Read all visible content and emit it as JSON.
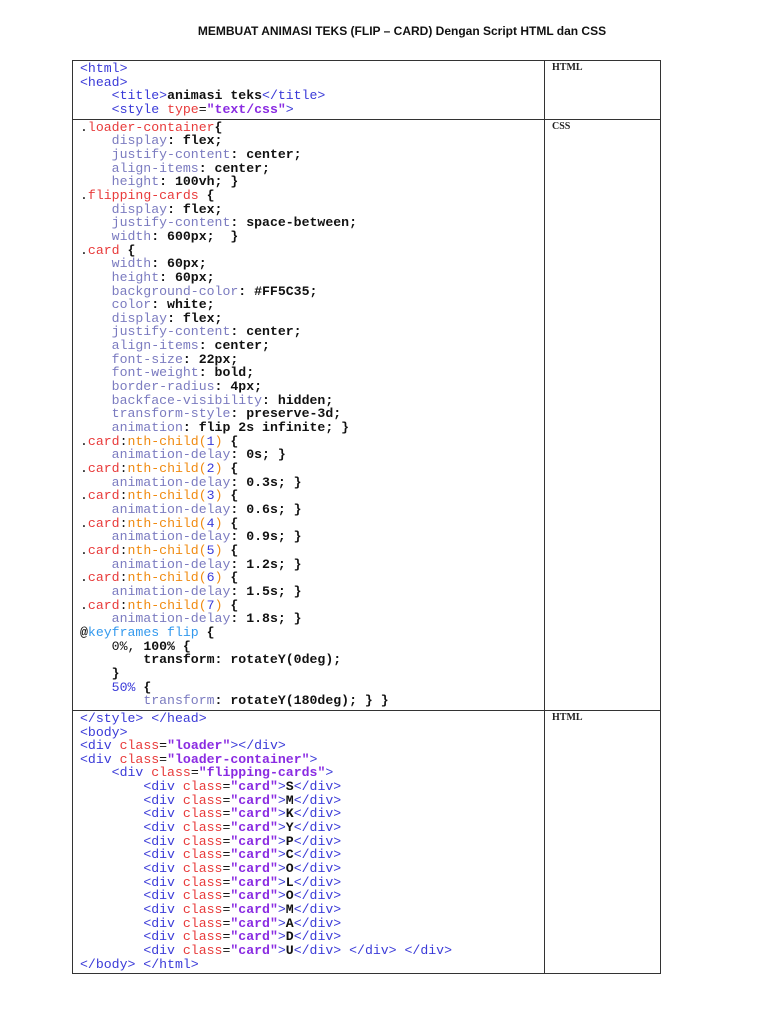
{
  "title": "MEMBUAT ANIMASI TEKS (FLIP – CARD) Dengan Script HTML dan CSS",
  "rows": [
    {
      "label": "HTML",
      "lines": [
        [
          [
            "t",
            "<html>"
          ]
        ],
        [
          [
            "t",
            "<head>"
          ]
        ],
        [
          [
            "d",
            "    "
          ],
          [
            "t",
            "<title>"
          ],
          [
            "k",
            "animasi teks"
          ],
          [
            "t",
            "</title>"
          ]
        ],
        [
          [
            "d",
            "    "
          ],
          [
            "t",
            "<style "
          ],
          [
            "a",
            "type"
          ],
          [
            "d",
            "="
          ],
          [
            "v",
            "\"text/css\""
          ],
          [
            "t",
            ">"
          ]
        ]
      ]
    },
    {
      "label": "CSS",
      "lines": [
        [
          [
            "d",
            "."
          ],
          [
            "s",
            "loader-container"
          ],
          [
            "k",
            "{"
          ]
        ],
        [
          [
            "d",
            "    "
          ],
          [
            "p",
            "display"
          ],
          [
            "k",
            ": flex;"
          ]
        ],
        [
          [
            "d",
            "    "
          ],
          [
            "p",
            "justify-content"
          ],
          [
            "k",
            ": center;"
          ]
        ],
        [
          [
            "d",
            "    "
          ],
          [
            "p",
            "align-items"
          ],
          [
            "k",
            ": center;"
          ]
        ],
        [
          [
            "d",
            "    "
          ],
          [
            "p",
            "height"
          ],
          [
            "k",
            ": 100vh; }"
          ]
        ],
        [
          [
            "d",
            "."
          ],
          [
            "s",
            "flipping-cards"
          ],
          [
            "k",
            " {"
          ]
        ],
        [
          [
            "d",
            "    "
          ],
          [
            "p",
            "display"
          ],
          [
            "k",
            ": flex;"
          ]
        ],
        [
          [
            "d",
            "    "
          ],
          [
            "p",
            "justify-content"
          ],
          [
            "k",
            ": space-between;"
          ]
        ],
        [
          [
            "d",
            "    "
          ],
          [
            "p",
            "width"
          ],
          [
            "k",
            ": 600px;  }"
          ]
        ],
        [
          [
            "d",
            "."
          ],
          [
            "s",
            "card"
          ],
          [
            "k",
            " {"
          ]
        ],
        [
          [
            "d",
            "    "
          ],
          [
            "p",
            "width"
          ],
          [
            "k",
            ": 60px;"
          ]
        ],
        [
          [
            "d",
            "    "
          ],
          [
            "p",
            "height"
          ],
          [
            "k",
            ": 60px;"
          ]
        ],
        [
          [
            "d",
            "    "
          ],
          [
            "p",
            "background-color"
          ],
          [
            "k",
            ": #FF5C35;"
          ]
        ],
        [
          [
            "d",
            "    "
          ],
          [
            "p",
            "color"
          ],
          [
            "k",
            ": white;"
          ]
        ],
        [
          [
            "d",
            "    "
          ],
          [
            "p",
            "display"
          ],
          [
            "k",
            ": flex;"
          ]
        ],
        [
          [
            "d",
            "    "
          ],
          [
            "p",
            "justify-content"
          ],
          [
            "k",
            ": center;"
          ]
        ],
        [
          [
            "d",
            "    "
          ],
          [
            "p",
            "align-items"
          ],
          [
            "k",
            ": center;"
          ]
        ],
        [
          [
            "d",
            "    "
          ],
          [
            "p",
            "font-size"
          ],
          [
            "k",
            ": 22px;"
          ]
        ],
        [
          [
            "d",
            "    "
          ],
          [
            "p",
            "font-weight"
          ],
          [
            "k",
            ": bold;"
          ]
        ],
        [
          [
            "d",
            "    "
          ],
          [
            "p",
            "border-radius"
          ],
          [
            "k",
            ": 4px;"
          ]
        ],
        [
          [
            "d",
            "    "
          ],
          [
            "p",
            "backface-visibility"
          ],
          [
            "k",
            ": hidden;"
          ]
        ],
        [
          [
            "d",
            "    "
          ],
          [
            "p",
            "transform-style"
          ],
          [
            "k",
            ": preserve-3d;"
          ]
        ],
        [
          [
            "d",
            "    "
          ],
          [
            "p",
            "animation"
          ],
          [
            "k",
            ": flip 2s infinite; }"
          ]
        ],
        [
          [
            "d",
            "."
          ],
          [
            "s",
            "card"
          ],
          [
            "d",
            ":"
          ],
          [
            "o",
            "nth-child("
          ],
          [
            "n",
            "1"
          ],
          [
            "o",
            ")"
          ],
          [
            "k",
            " {"
          ]
        ],
        [
          [
            "d",
            "    "
          ],
          [
            "p",
            "animation-delay"
          ],
          [
            "k",
            ": 0s; }"
          ]
        ],
        [
          [
            "d",
            "."
          ],
          [
            "s",
            "card"
          ],
          [
            "d",
            ":"
          ],
          [
            "o",
            "nth-child("
          ],
          [
            "n",
            "2"
          ],
          [
            "o",
            ")"
          ],
          [
            "k",
            " {"
          ]
        ],
        [
          [
            "d",
            "    "
          ],
          [
            "p",
            "animation-delay"
          ],
          [
            "k",
            ": 0.3s; }"
          ]
        ],
        [
          [
            "d",
            "."
          ],
          [
            "s",
            "card"
          ],
          [
            "d",
            ":"
          ],
          [
            "o",
            "nth-child("
          ],
          [
            "n",
            "3"
          ],
          [
            "o",
            ")"
          ],
          [
            "k",
            " {"
          ]
        ],
        [
          [
            "d",
            "    "
          ],
          [
            "p",
            "animation-delay"
          ],
          [
            "k",
            ": 0.6s; }"
          ]
        ],
        [
          [
            "d",
            "."
          ],
          [
            "s",
            "card"
          ],
          [
            "d",
            ":"
          ],
          [
            "o",
            "nth-child("
          ],
          [
            "n",
            "4"
          ],
          [
            "o",
            ")"
          ],
          [
            "k",
            " {"
          ]
        ],
        [
          [
            "d",
            "    "
          ],
          [
            "p",
            "animation-delay"
          ],
          [
            "k",
            ": 0.9s; }"
          ]
        ],
        [
          [
            "d",
            "."
          ],
          [
            "s",
            "card"
          ],
          [
            "d",
            ":"
          ],
          [
            "o",
            "nth-child("
          ],
          [
            "n",
            "5"
          ],
          [
            "o",
            ")"
          ],
          [
            "k",
            " {"
          ]
        ],
        [
          [
            "d",
            "    "
          ],
          [
            "p",
            "animation-delay"
          ],
          [
            "k",
            ": 1.2s; }"
          ]
        ],
        [
          [
            "d",
            "."
          ],
          [
            "s",
            "card"
          ],
          [
            "d",
            ":"
          ],
          [
            "o",
            "nth-child("
          ],
          [
            "n",
            "6"
          ],
          [
            "o",
            ")"
          ],
          [
            "k",
            " {"
          ]
        ],
        [
          [
            "d",
            "    "
          ],
          [
            "p",
            "animation-delay"
          ],
          [
            "k",
            ": 1.5s; }"
          ]
        ],
        [
          [
            "d",
            "."
          ],
          [
            "s",
            "card"
          ],
          [
            "d",
            ":"
          ],
          [
            "o",
            "nth-child("
          ],
          [
            "n",
            "7"
          ],
          [
            "o",
            ")"
          ],
          [
            "k",
            " {"
          ]
        ],
        [
          [
            "d",
            "    "
          ],
          [
            "p",
            "animation-delay"
          ],
          [
            "k",
            ": 1.8s; }"
          ]
        ],
        [
          [
            "k",
            "@"
          ],
          [
            "kw",
            "keyframes flip"
          ],
          [
            "k",
            " {"
          ]
        ],
        [
          [
            "d",
            "    0%, "
          ],
          [
            "k",
            "100% {"
          ]
        ],
        [
          [
            "d",
            "        "
          ],
          [
            "k",
            "transform: rotateY(0deg);"
          ]
        ],
        [
          [
            "d",
            "    "
          ],
          [
            "k",
            "}"
          ]
        ],
        [
          [
            "d",
            "    "
          ],
          [
            "n",
            "50%"
          ],
          [
            "k",
            " {"
          ]
        ],
        [
          [
            "d",
            "        "
          ],
          [
            "p",
            "transform"
          ],
          [
            "k",
            ": rotateY(180deg); } }"
          ]
        ]
      ]
    },
    {
      "label": "HTML",
      "lines": [
        [
          [
            "t",
            "</style> </head>"
          ]
        ],
        [
          [
            "t",
            "<body>"
          ]
        ],
        [
          [
            "t",
            "<div "
          ],
          [
            "a",
            "class"
          ],
          [
            "d",
            "="
          ],
          [
            "v",
            "\"loader\""
          ],
          [
            "t",
            "></div>"
          ]
        ],
        [
          [
            "t",
            "<div "
          ],
          [
            "a",
            "class"
          ],
          [
            "d",
            "="
          ],
          [
            "v",
            "\"loader-container\""
          ],
          [
            "t",
            ">"
          ]
        ],
        [
          [
            "d",
            "    "
          ],
          [
            "t",
            "<div "
          ],
          [
            "a",
            "class"
          ],
          [
            "d",
            "="
          ],
          [
            "v",
            "\"flipping-cards\""
          ],
          [
            "t",
            ">"
          ]
        ],
        [
          [
            "d",
            "        "
          ],
          [
            "t",
            "<div "
          ],
          [
            "a",
            "class"
          ],
          [
            "d",
            "="
          ],
          [
            "v",
            "\"card\""
          ],
          [
            "t",
            ">"
          ],
          [
            "k",
            "S"
          ],
          [
            "t",
            "</div>"
          ]
        ],
        [
          [
            "d",
            "        "
          ],
          [
            "t",
            "<div "
          ],
          [
            "a",
            "class"
          ],
          [
            "d",
            "="
          ],
          [
            "v",
            "\"card\""
          ],
          [
            "t",
            ">"
          ],
          [
            "k",
            "M"
          ],
          [
            "t",
            "</div>"
          ]
        ],
        [
          [
            "d",
            "        "
          ],
          [
            "t",
            "<div "
          ],
          [
            "a",
            "class"
          ],
          [
            "d",
            "="
          ],
          [
            "v",
            "\"card\""
          ],
          [
            "t",
            ">"
          ],
          [
            "k",
            "K"
          ],
          [
            "t",
            "</div>"
          ]
        ],
        [
          [
            "d",
            "        "
          ],
          [
            "t",
            "<div "
          ],
          [
            "a",
            "class"
          ],
          [
            "d",
            "="
          ],
          [
            "v",
            "\"card\""
          ],
          [
            "t",
            ">"
          ],
          [
            "k",
            "Y"
          ],
          [
            "t",
            "</div>"
          ]
        ],
        [
          [
            "d",
            "        "
          ],
          [
            "t",
            "<div "
          ],
          [
            "a",
            "class"
          ],
          [
            "d",
            "="
          ],
          [
            "v",
            "\"card\""
          ],
          [
            "t",
            ">"
          ],
          [
            "k",
            "P"
          ],
          [
            "t",
            "</div>"
          ]
        ],
        [
          [
            "d",
            "        "
          ],
          [
            "t",
            "<div "
          ],
          [
            "a",
            "class"
          ],
          [
            "d",
            "="
          ],
          [
            "v",
            "\"card\""
          ],
          [
            "t",
            ">"
          ],
          [
            "k",
            "C"
          ],
          [
            "t",
            "</div>"
          ]
        ],
        [
          [
            "d",
            "        "
          ],
          [
            "t",
            "<div "
          ],
          [
            "a",
            "class"
          ],
          [
            "d",
            "="
          ],
          [
            "v",
            "\"card\""
          ],
          [
            "t",
            ">"
          ],
          [
            "k",
            "O"
          ],
          [
            "t",
            "</div>"
          ]
        ],
        [
          [
            "d",
            "        "
          ],
          [
            "t",
            "<div "
          ],
          [
            "a",
            "class"
          ],
          [
            "d",
            "="
          ],
          [
            "v",
            "\"card\""
          ],
          [
            "t",
            ">"
          ],
          [
            "k",
            "L"
          ],
          [
            "t",
            "</div>"
          ]
        ],
        [
          [
            "d",
            "        "
          ],
          [
            "t",
            "<div "
          ],
          [
            "a",
            "class"
          ],
          [
            "d",
            "="
          ],
          [
            "v",
            "\"card\""
          ],
          [
            "t",
            ">"
          ],
          [
            "k",
            "O"
          ],
          [
            "t",
            "</div>"
          ]
        ],
        [
          [
            "d",
            "        "
          ],
          [
            "t",
            "<div "
          ],
          [
            "a",
            "class"
          ],
          [
            "d",
            "="
          ],
          [
            "v",
            "\"card\""
          ],
          [
            "t",
            ">"
          ],
          [
            "k",
            "M"
          ],
          [
            "t",
            "</div>"
          ]
        ],
        [
          [
            "d",
            "        "
          ],
          [
            "t",
            "<div "
          ],
          [
            "a",
            "class"
          ],
          [
            "d",
            "="
          ],
          [
            "v",
            "\"card\""
          ],
          [
            "t",
            ">"
          ],
          [
            "k",
            "A"
          ],
          [
            "t",
            "</div>"
          ]
        ],
        [
          [
            "d",
            "        "
          ],
          [
            "t",
            "<div "
          ],
          [
            "a",
            "class"
          ],
          [
            "d",
            "="
          ],
          [
            "v",
            "\"card\""
          ],
          [
            "t",
            ">"
          ],
          [
            "k",
            "D"
          ],
          [
            "t",
            "</div>"
          ]
        ],
        [
          [
            "d",
            "        "
          ],
          [
            "t",
            "<div "
          ],
          [
            "a",
            "class"
          ],
          [
            "d",
            "="
          ],
          [
            "v",
            "\"card\""
          ],
          [
            "t",
            ">"
          ],
          [
            "k",
            "U"
          ],
          [
            "t",
            "</div> </div> </div>"
          ]
        ],
        [
          [
            "t",
            "</body> </html>"
          ]
        ]
      ]
    }
  ]
}
